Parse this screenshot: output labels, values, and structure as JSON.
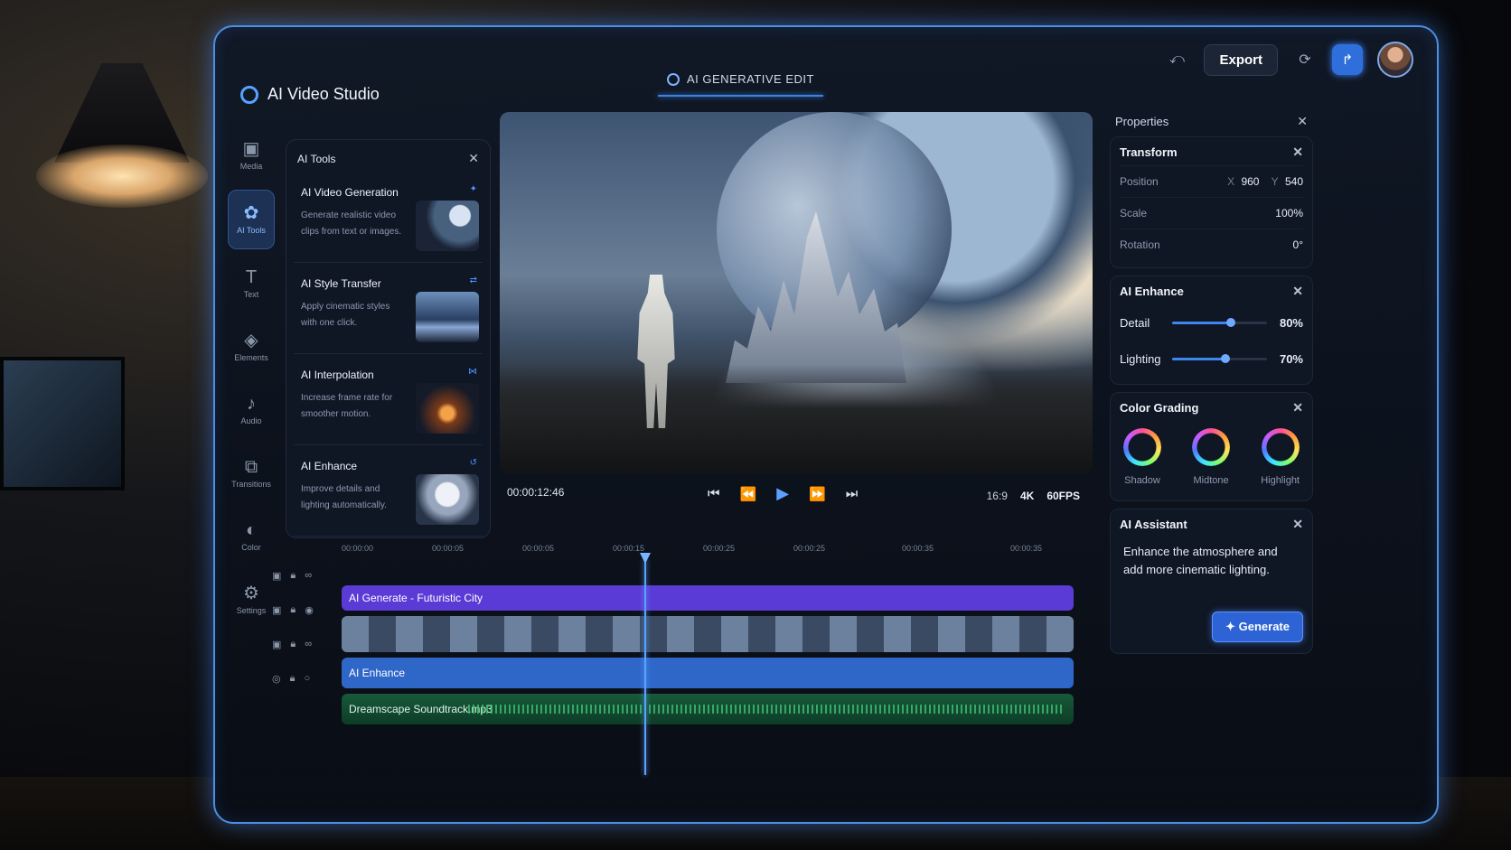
{
  "app": {
    "title": "AI Video Studio"
  },
  "header": {
    "center_title": "AI GENERATIVE EDIT",
    "export_label": "Export"
  },
  "sidebar": {
    "items": [
      {
        "label": "Media",
        "icon": "media-icon"
      },
      {
        "label": "AI Tools",
        "icon": "ai-tools-icon"
      },
      {
        "label": "Text",
        "icon": "text-icon"
      },
      {
        "label": "Elements",
        "icon": "elements-icon"
      },
      {
        "label": "Audio",
        "icon": "audio-icon"
      },
      {
        "label": "Transitions",
        "icon": "transitions-icon"
      },
      {
        "label": "Color",
        "icon": "color-icon"
      },
      {
        "label": "Settings",
        "icon": "settings-icon"
      }
    ]
  },
  "tools_panel": {
    "title": "AI Tools",
    "cards": [
      {
        "title": "AI Video Generation",
        "desc": "Generate realistic video clips from text or images."
      },
      {
        "title": "AI Style Transfer",
        "desc": "Apply cinematic styles with one click."
      },
      {
        "title": "AI Interpolation",
        "desc": "Increase frame rate for smoother motion."
      },
      {
        "title": "AI Enhance",
        "desc": "Improve details and lighting automatically."
      }
    ]
  },
  "player": {
    "timecode": "00:00:12:46",
    "aspect": "16:9",
    "resolution": "4K",
    "fps": "60FPS"
  },
  "properties": {
    "title": "Properties",
    "transform": {
      "title": "Transform",
      "position_label": "Position",
      "x_label": "X",
      "x_value": "960",
      "y_label": "Y",
      "y_value": "540",
      "scale_label": "Scale",
      "scale_value": "100%",
      "rotation_label": "Rotation",
      "rotation_value": "0°"
    },
    "enhance": {
      "title": "AI Enhance",
      "detail_label": "Detail",
      "detail_value": "80%",
      "detail_level": 0.62,
      "lighting_label": "Lighting",
      "lighting_value": "70%",
      "lighting_level": 0.56
    },
    "color_grading": {
      "title": "Color Grading",
      "wheels": [
        "Shadow",
        "Midtone",
        "Highlight"
      ]
    },
    "assistant": {
      "title": "AI Assistant",
      "text": "Enhance the atmosphere and add more cinematic lighting.",
      "generate_label": "Generate"
    }
  },
  "timeline": {
    "ruler": [
      "00:00:00",
      "00:00:05",
      "00:00:05",
      "00:00:15",
      "00:00:25",
      "00:00:25",
      "00:00:35",
      "00:00:35"
    ],
    "tracks": [
      {
        "label": "AI Generate - Futuristic City"
      },
      {
        "label": ""
      },
      {
        "label": "AI Enhance"
      },
      {
        "label": "Dreamscape Soundtrack.mp3"
      }
    ]
  }
}
